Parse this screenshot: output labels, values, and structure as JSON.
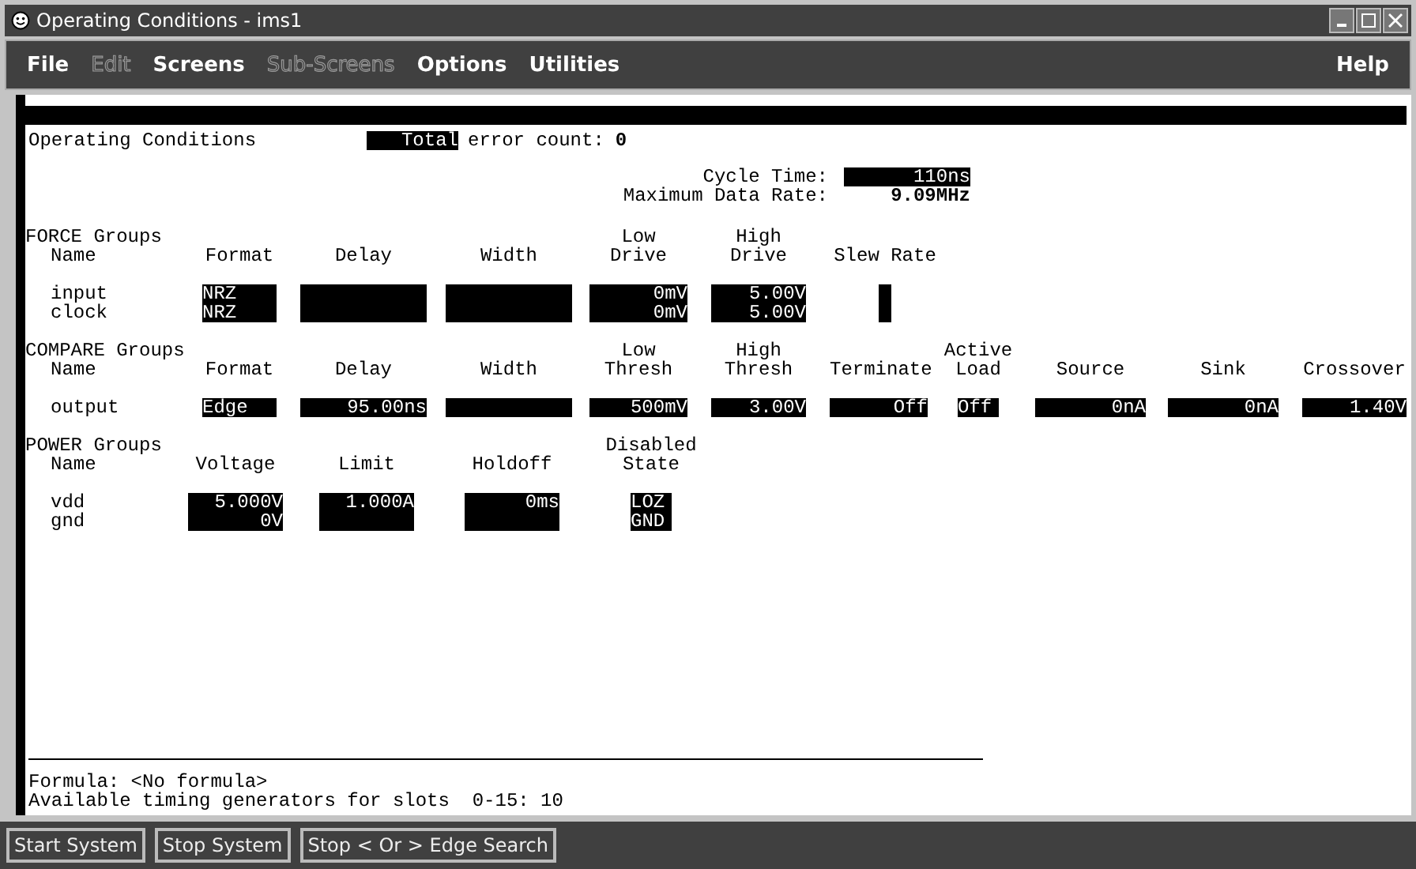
{
  "window": {
    "title": "Operating Conditions - ims1"
  },
  "menu": [
    {
      "label": "File",
      "disabled": false
    },
    {
      "label": "Edit",
      "disabled": true
    },
    {
      "label": "Screens",
      "disabled": false
    },
    {
      "label": "Sub-Screens",
      "disabled": true
    },
    {
      "label": "Options",
      "disabled": false
    },
    {
      "label": "Utilities",
      "disabled": false
    },
    {
      "label": "Help",
      "disabled": false
    }
  ],
  "header": {
    "title": "Operating Conditions",
    "total_field": "Total",
    "error_label": "error count:",
    "error_count": "0"
  },
  "timing": {
    "cycle_label": "Cycle Time:",
    "cycle_value": "110ns",
    "rate_label": "Maximum Data Rate:",
    "rate_value": "9.09MHz"
  },
  "groups": [
    {
      "kind": "force",
      "title": "FORCE Groups",
      "columns": [
        {
          "kind": "name",
          "header": [
            "Name"
          ],
          "values": [
            "input",
            "clock"
          ]
        },
        {
          "kind": "text",
          "header": [
            "Format"
          ],
          "values": [
            "NRZ",
            "NRZ"
          ]
        },
        {
          "kind": "number",
          "header": [
            "Delay"
          ]
        },
        {
          "kind": "number",
          "header": [
            "Width"
          ]
        },
        {
          "kind": "number",
          "header": [
            "Low",
            "Drive"
          ],
          "values": [
            "0mV",
            "0mV"
          ]
        },
        {
          "kind": "number",
          "header": [
            "High",
            "Drive"
          ],
          "values": [
            "5.00V",
            "5.00V"
          ]
        },
        {
          "kind": "number",
          "header": [
            "Slew Rate"
          ]
        }
      ]
    },
    {
      "kind": "compare",
      "title": "COMPARE Groups",
      "columns": [
        {
          "kind": "name",
          "header": [
            "Name"
          ],
          "values": [
            "output"
          ]
        },
        {
          "kind": "text",
          "header": [
            "Format"
          ],
          "values": [
            "Edge"
          ]
        },
        {
          "kind": "number",
          "header": [
            "Delay"
          ],
          "values": [
            "95.00ns"
          ]
        },
        {
          "kind": "number",
          "header": [
            "Width"
          ]
        },
        {
          "kind": "number",
          "header": [
            "Low",
            "Thresh"
          ],
          "values": [
            "500mV"
          ]
        },
        {
          "kind": "number",
          "header": [
            "High",
            "Thresh"
          ],
          "values": [
            "3.00V"
          ]
        },
        {
          "kind": "number",
          "header": [
            "Terminate"
          ],
          "values": [
            "Off"
          ]
        },
        {
          "kind": "text",
          "header": [
            "Active",
            "Load"
          ],
          "values": [
            "Off"
          ]
        },
        {
          "kind": "number",
          "header": [
            "Source"
          ],
          "values": [
            "0nA"
          ]
        },
        {
          "kind": "number",
          "header": [
            "Sink"
          ],
          "values": [
            "0nA"
          ]
        },
        {
          "kind": "number",
          "header": [
            "Crossover"
          ],
          "values": [
            "1.40V"
          ]
        }
      ]
    },
    {
      "kind": "power",
      "title": "POWER Groups",
      "columns": [
        {
          "kind": "name",
          "header": [
            "Name"
          ],
          "values": [
            "vdd",
            "gnd"
          ]
        },
        {
          "kind": "number",
          "header": [
            "Voltage"
          ],
          "values": [
            "5.000V",
            "0V"
          ]
        },
        {
          "kind": "number",
          "header": [
            "Limit"
          ],
          "values": [
            "1.000A"
          ]
        },
        {
          "kind": "number",
          "header": [
            "Holdoff"
          ],
          "values": [
            "0ms"
          ]
        },
        {
          "kind": "text",
          "header": [
            "Disabled",
            "State"
          ],
          "values": [
            "LOZ",
            "GND"
          ]
        }
      ]
    }
  ],
  "footer": {
    "formula": "Formula: <No formula>",
    "generators": "Available timing generators for slots  0-15: 10"
  },
  "buttons": [
    "Start System",
    "Stop System",
    "Stop < Or > Edge Search"
  ]
}
